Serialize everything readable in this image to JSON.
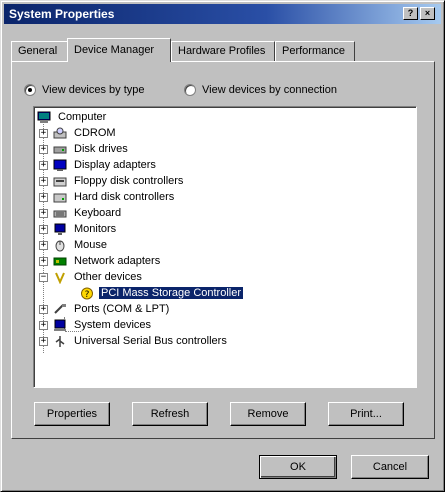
{
  "window": {
    "title": "System Properties"
  },
  "titlebar_buttons": {
    "help": "?",
    "close": "×"
  },
  "tabs": [
    "General",
    "Device Manager",
    "Hardware Profiles",
    "Performance"
  ],
  "radio": {
    "by_type": "View devices by type",
    "by_connection": "View devices by connection",
    "selected": "by_type"
  },
  "tree": {
    "root": "Computer",
    "items": [
      {
        "label": "CDROM",
        "expander": "+"
      },
      {
        "label": "Disk drives",
        "expander": "+"
      },
      {
        "label": "Display adapters",
        "expander": "+"
      },
      {
        "label": "Floppy disk controllers",
        "expander": "+"
      },
      {
        "label": "Hard disk controllers",
        "expander": "+"
      },
      {
        "label": "Keyboard",
        "expander": "+"
      },
      {
        "label": "Monitors",
        "expander": "+"
      },
      {
        "label": "Mouse",
        "expander": "+"
      },
      {
        "label": "Network adapters",
        "expander": "+"
      },
      {
        "label": "Other devices",
        "expander": "−"
      },
      {
        "label": "PCI Mass Storage Controller",
        "child": true,
        "selected": true
      },
      {
        "label": "Ports (COM & LPT)",
        "expander": "+"
      },
      {
        "label": "System devices",
        "expander": "+"
      },
      {
        "label": "Universal Serial Bus controllers",
        "expander": "+"
      }
    ]
  },
  "buttons": {
    "properties": "Properties",
    "refresh": "Refresh",
    "remove": "Remove",
    "print": "Print...",
    "ok": "OK",
    "cancel": "Cancel"
  },
  "icons": [
    "computer-icon",
    "cdrom-icon",
    "disk-drive-icon",
    "display-adapter-icon",
    "floppy-controller-icon",
    "hard-disk-controller-icon",
    "keyboard-icon",
    "monitor-icon",
    "mouse-icon",
    "network-adapter-icon",
    "other-devices-icon",
    "warning-device-icon",
    "ports-icon",
    "system-devices-icon",
    "usb-icon"
  ],
  "colors": {
    "titlebar": "#0a246a",
    "selection": "#0a246a",
    "annotation": "#e00000"
  }
}
